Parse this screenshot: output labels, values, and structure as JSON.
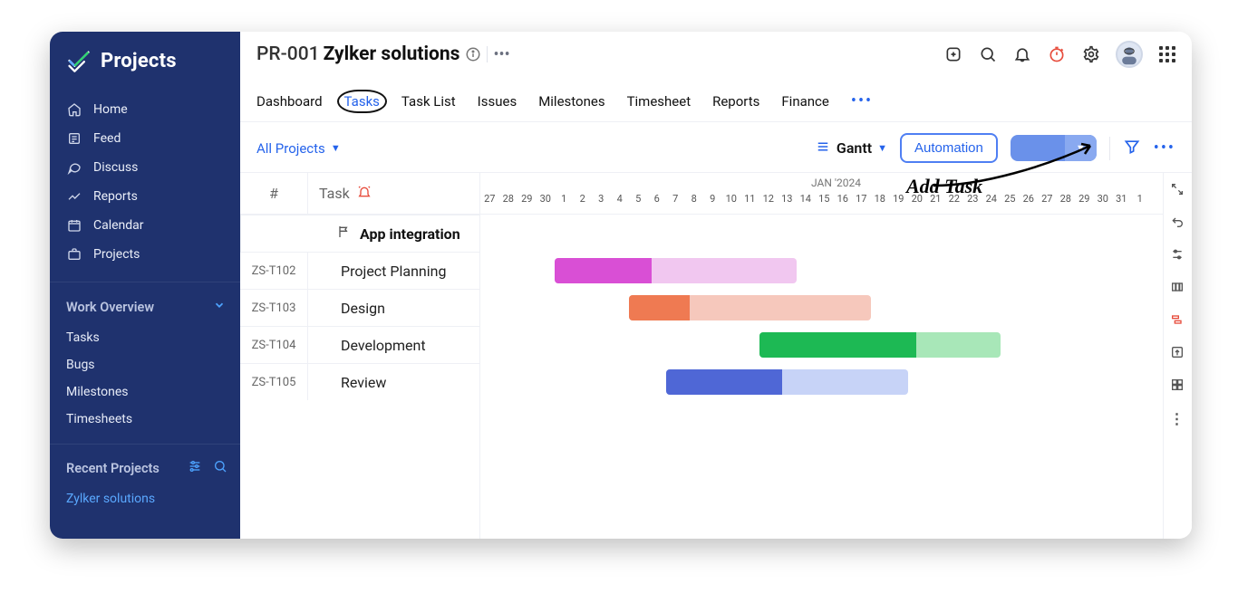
{
  "brand": {
    "title": "Projects"
  },
  "nav": {
    "items": [
      {
        "icon": "home",
        "label": "Home"
      },
      {
        "icon": "feed",
        "label": "Feed"
      },
      {
        "icon": "discuss",
        "label": "Discuss"
      },
      {
        "icon": "reports",
        "label": "Reports"
      },
      {
        "icon": "calendar",
        "label": "Calendar"
      },
      {
        "icon": "projects",
        "label": "Projects"
      }
    ]
  },
  "work_overview": {
    "title": "Work Overview",
    "items": [
      "Tasks",
      "Bugs",
      "Milestones",
      "Timesheets"
    ]
  },
  "recent": {
    "title": "Recent Projects",
    "items": [
      "Zylker solutions"
    ]
  },
  "breadcrumb": {
    "code": "PR-001",
    "name": "Zylker solutions"
  },
  "tabs": {
    "items": [
      "Dashboard",
      "Tasks",
      "Task List",
      "Issues",
      "Milestones",
      "Timesheet",
      "Reports",
      "Finance"
    ],
    "active": "Tasks"
  },
  "toolbar": {
    "all_projects": "All Projects",
    "view_label": "Gantt",
    "automation_label": "Automation",
    "add_task_label": ""
  },
  "gantt": {
    "header": {
      "hash": "#",
      "task": "Task"
    },
    "month_label": "JAN '2024",
    "days": [
      27,
      28,
      29,
      30,
      1,
      2,
      3,
      4,
      5,
      6,
      7,
      8,
      9,
      10,
      11,
      12,
      13,
      14,
      15,
      16,
      17,
      18,
      19,
      20,
      21,
      22,
      23,
      24,
      25,
      26,
      27,
      28,
      29,
      30,
      31,
      1
    ],
    "group": "App integration",
    "rows": [
      {
        "id": "ZS-T102",
        "task": "Project Planning"
      },
      {
        "id": "ZS-T103",
        "task": "Design"
      },
      {
        "id": "ZS-T104",
        "task": "Development"
      },
      {
        "id": "ZS-T105",
        "task": "Review"
      }
    ],
    "bars": [
      {
        "row": 0,
        "color": "pink",
        "start_idx": 4,
        "end_idx": 17,
        "progress": 0.4
      },
      {
        "row": 1,
        "color": "orange",
        "start_idx": 8,
        "end_idx": 21,
        "progress": 0.25
      },
      {
        "row": 2,
        "color": "green",
        "start_idx": 15,
        "end_idx": 28,
        "progress": 0.65
      },
      {
        "row": 3,
        "color": "blue",
        "start_idx": 10,
        "end_idx": 23,
        "progress": 0.48
      }
    ]
  },
  "annotations": {
    "tasks_circle": true,
    "add_task_label": "Add Task"
  }
}
